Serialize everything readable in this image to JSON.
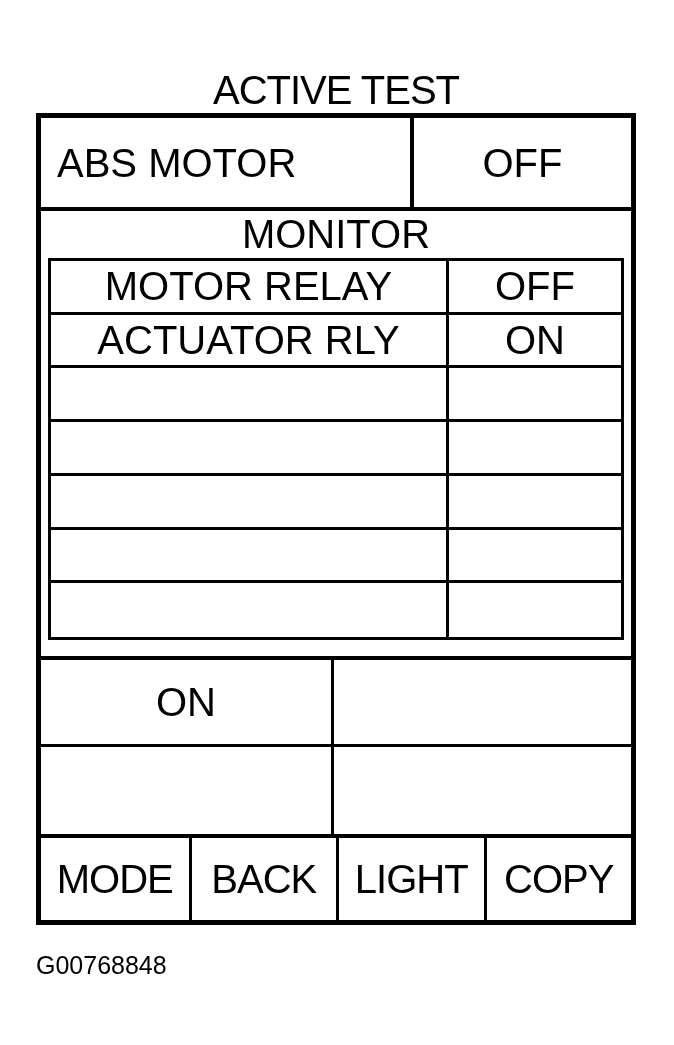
{
  "title": "ACTIVE TEST",
  "test_item": {
    "label": "ABS MOTOR",
    "value": "OFF"
  },
  "monitor": {
    "heading": "MONITOR",
    "rows": [
      {
        "label": "MOTOR RELAY",
        "value": "OFF"
      },
      {
        "label": "ACTUATOR RLY",
        "value": "ON"
      }
    ]
  },
  "display": {
    "cells": [
      "ON"
    ]
  },
  "buttons": [
    "MODE",
    "BACK",
    "LIGHT",
    "COPY"
  ],
  "figure_code": "G00768848"
}
